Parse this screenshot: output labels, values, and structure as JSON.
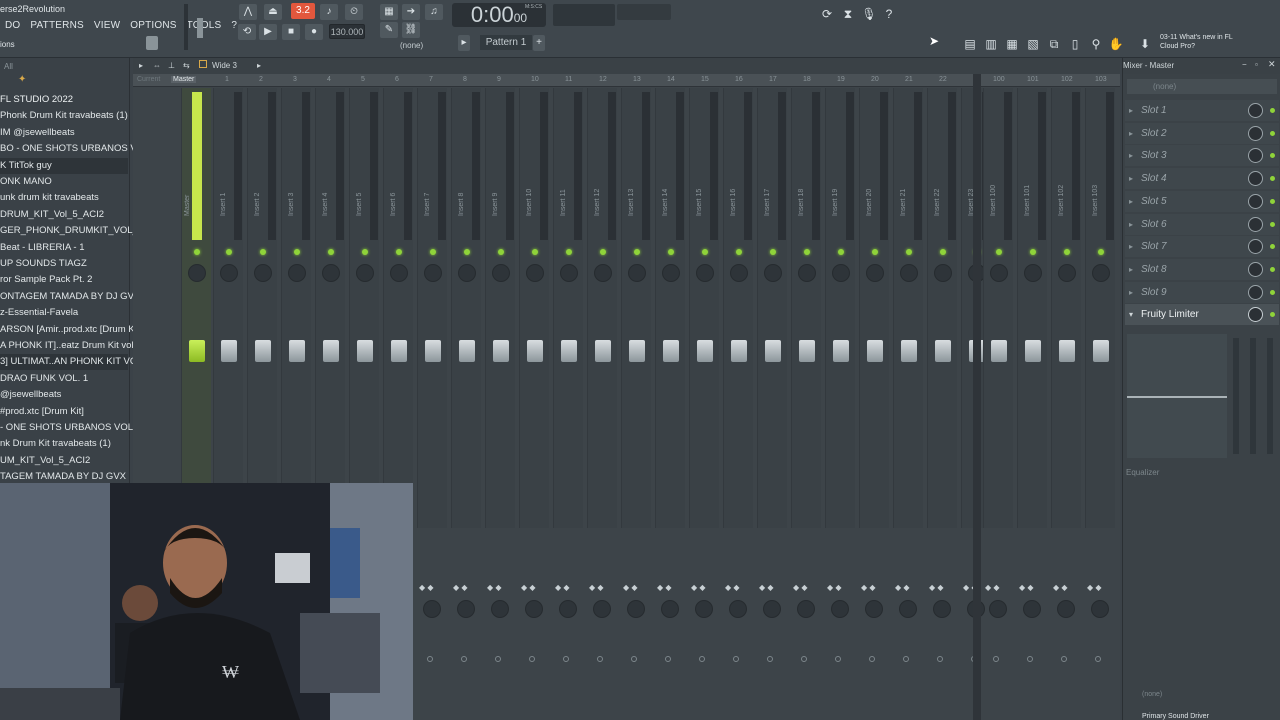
{
  "window": {
    "title": "erse2Revolution",
    "menu": [
      "DO",
      "PATTERNS",
      "VIEW",
      "OPTIONS",
      "TOOLS",
      "?"
    ],
    "hint": "ions"
  },
  "transport": {
    "song_pos": "3.2",
    "tempo": "130.000",
    "time_main": "0:00",
    "time_sub": "00",
    "time_unit": "M:S:CS",
    "pattern": "Pattern 1",
    "snap": "(none)"
  },
  "news": {
    "date": "03-11",
    "line1": "What's new in FL",
    "line2": "Cloud Pro?"
  },
  "browser": {
    "filter": "All",
    "items": [
      "FL STUDIO 2022",
      "Phonk Drum Kit travabeats (1)",
      "IM @jsewellbeats",
      "BO - ONE SHOTS URBANOS VOL. 2",
      "K TitTok guy",
      "ONK MANO",
      "unk drum kit travabeats",
      "DRUM_KIT_Vol_5_ACI2",
      "GER_PHONK_DRUMKIT_VOL_3",
      "Beat - LIBRERIA - 1",
      "UP SOUNDS TIAGZ",
      "ror Sample Pack Pt. 2",
      "ONTAGEM TAMADA BY DJ GVX",
      "z-Essential-Favela",
      "ARSON [Amir..prod.xtc [Drum Kit]",
      "A PHONK IT]..eatz Drum Kit vol 1",
      "3] ULTIMAT..AN PHONK KIT VOL. 3",
      "DRAO FUNK VOL. 1",
      "@jsewellbeats",
      "#prod.xtc [Drum Kit]",
      "- ONE SHOTS URBANOS VOL. 2",
      "nk Drum Kit travabeats (1)",
      "UM_KIT_Vol_5_ACI2",
      "TAGEM TAMADA BY DJ GVX"
    ]
  },
  "mixer": {
    "tab_current": "Current",
    "tab_master": "Master",
    "view_mode": "Wide 3",
    "master_label": "Master",
    "inserts": [
      "Insert 1",
      "Insert 2",
      "Insert 3",
      "Insert 4",
      "Insert 5",
      "Insert 6",
      "Insert 7",
      "Insert 8",
      "Insert 9",
      "Insert 10",
      "Insert 11",
      "Insert 12",
      "Insert 13",
      "Insert 14",
      "Insert 15",
      "Insert 16",
      "Insert 17",
      "Insert 18",
      "Insert 19",
      "Insert 20",
      "Insert 21",
      "Insert 22",
      "Insert 23"
    ],
    "inserts_right": [
      "Insert 100",
      "Insert 101",
      "Insert 102",
      "Insert 103"
    ],
    "ruler": [
      "1",
      "2",
      "3",
      "4",
      "5",
      "6",
      "7",
      "8",
      "9",
      "10",
      "11",
      "12",
      "13",
      "14",
      "15",
      "16",
      "17",
      "18",
      "19",
      "20",
      "21",
      "22",
      "23"
    ],
    "ruler_right": [
      "100",
      "101",
      "102",
      "103"
    ]
  },
  "slots_panel": {
    "title": "Mixer - Master",
    "preset": "(none)",
    "slots": [
      "Slot 1",
      "Slot 2",
      "Slot 3",
      "Slot 4",
      "Slot 5",
      "Slot 6",
      "Slot 7",
      "Slot 8",
      "Slot 9"
    ],
    "plugin": "Fruity Limiter",
    "eq_label": "Equalizer",
    "out_none": "(none)",
    "driver": "Primary Sound Driver"
  }
}
